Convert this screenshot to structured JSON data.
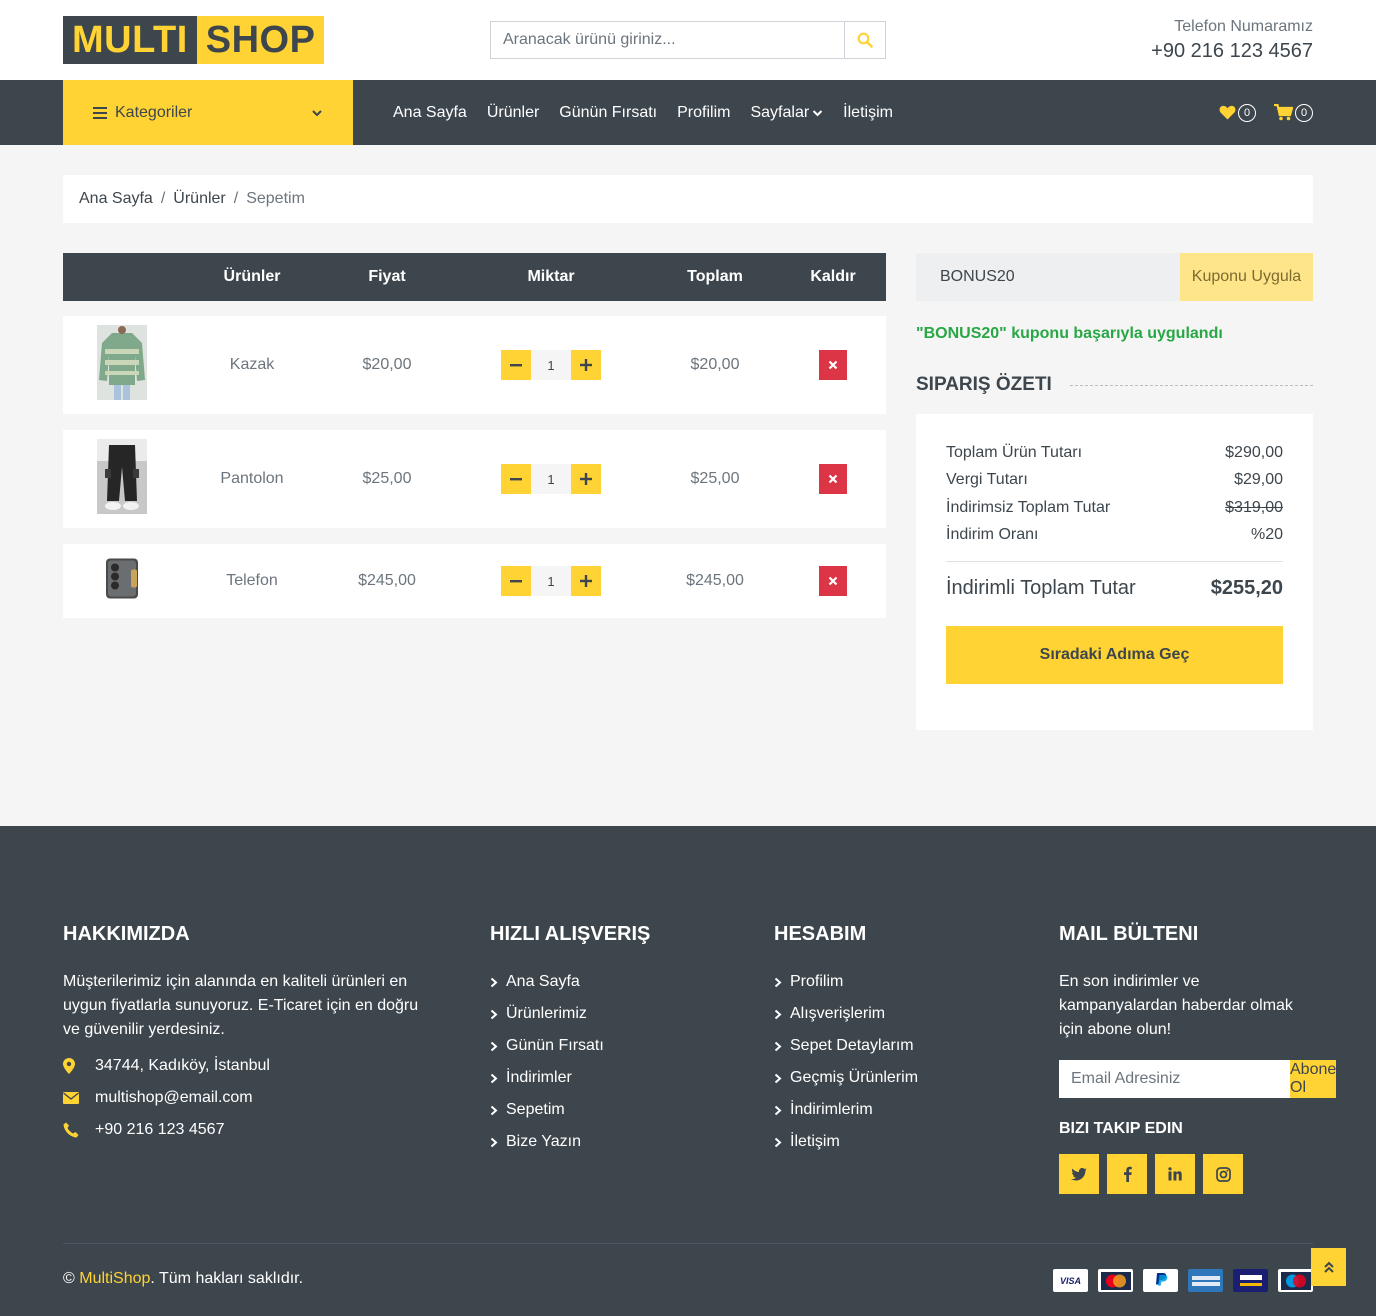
{
  "header": {
    "logo_part1": "MULTI",
    "logo_part2": "SHOP",
    "search_placeholder": "Aranacak ürünü giriniz...",
    "phone_label": "Telefon Numaramız",
    "phone_number": "+90 216 123 4567"
  },
  "nav": {
    "categories_label": "Kategoriler",
    "links": [
      "Ana Sayfa",
      "Ürünler",
      "Günün Fırsatı",
      "Profilim",
      "Sayfalar",
      "İletişim"
    ],
    "wishlist_count": "0",
    "cart_count": "0"
  },
  "breadcrumb": {
    "items": [
      "Ana Sayfa",
      "Ürünler"
    ],
    "current": "Sepetim"
  },
  "cart": {
    "columns": [
      "Ürünler",
      "Fiyat",
      "Miktar",
      "Toplam",
      "Kaldır"
    ],
    "rows": [
      {
        "name": "Kazak",
        "price": "$20,00",
        "qty": "1",
        "total": "$20,00"
      },
      {
        "name": "Pantolon",
        "price": "$25,00",
        "qty": "1",
        "total": "$25,00"
      },
      {
        "name": "Telefon",
        "price": "$245,00",
        "qty": "1",
        "total": "$245,00"
      }
    ]
  },
  "coupon": {
    "value": "BONUS20",
    "button": "Kuponu Uygula",
    "message": "\"BONUS20\" kuponu başarıyla uygulandı"
  },
  "summary": {
    "title": "SIPARIŞ ÖZETI",
    "lines": [
      {
        "label": "Toplam Ürün Tutarı",
        "value": "$290,00"
      },
      {
        "label": "Vergi Tutarı",
        "value": "$29,00"
      },
      {
        "label": "İndirimsiz Toplam Tutar",
        "value": "$319,00"
      },
      {
        "label": "İndirim Oranı",
        "value": "%20"
      }
    ],
    "total_label": "İndirimli Toplam Tutar",
    "total_value": "$255,20",
    "next_button": "Sıradaki Adıma Geç"
  },
  "footer": {
    "about_title": "HAKKIMIZDA",
    "about_text": "Müşterilerimiz için alanında en kaliteli ürünleri en uygun fiyatlarla sunuyoruz. E-Ticaret için en doğru ve güvenilir yerdesiniz.",
    "address": "34744, Kadıköy, İstanbul",
    "email": "multishop@email.com",
    "phone": "+90 216 123 4567",
    "quick_title": "HIZLI ALIŞVERIŞ",
    "quick_links": [
      "Ana Sayfa",
      "Ürünlerimiz",
      "Günün Fırsatı",
      "İndirimler",
      "Sepetim",
      "Bize Yazın"
    ],
    "account_title": "HESABIM",
    "account_links": [
      "Profilim",
      "Alışverişlerim",
      "Sepet Detaylarım",
      "Geçmiş Ürünlerim",
      "İndirimlerim",
      "İletişim"
    ],
    "newsletter_title": "MAIL BÜLTENI",
    "newsletter_text": "En son indirimler ve kampanyalardan haberdar olmak için abone olun!",
    "newsletter_placeholder": "Email Adresiniz",
    "newsletter_button": "Abone Ol",
    "follow_title": "BIZI TAKIP EDIN",
    "copyright_symbol": "©",
    "copyright_brand": "MultiShop",
    "copyright_rest": ". Tüm hakları saklıdır.",
    "payments": [
      "VISA",
      "MasterCard",
      "PayPal",
      "AMERICAN EXPRESS",
      "VISA Electron",
      "Maestro"
    ]
  },
  "colors": {
    "accent": "#ffd333",
    "dark": "#3d464d",
    "success": "#28a745",
    "danger": "#dc3545"
  }
}
